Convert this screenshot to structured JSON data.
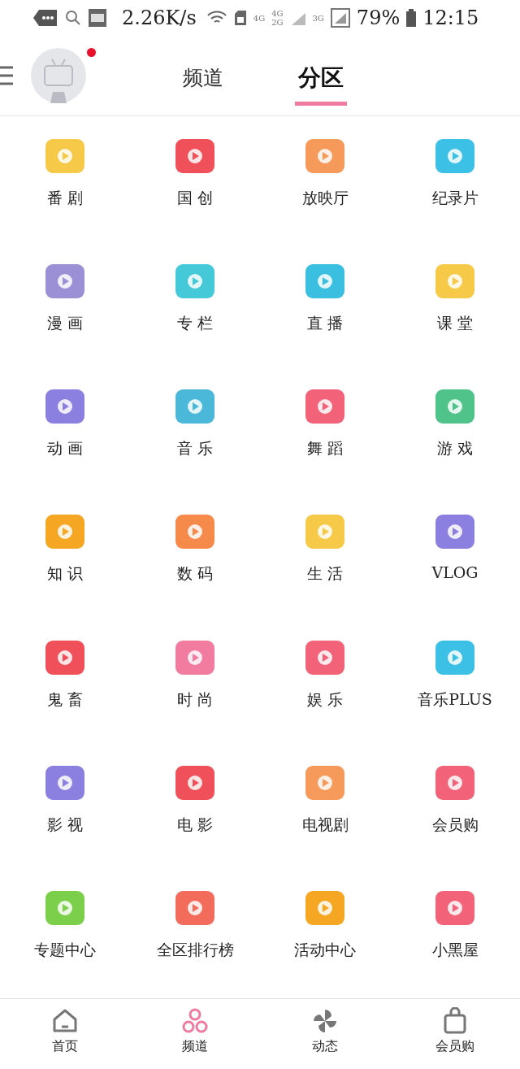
{
  "status_bar": {
    "speed": "2.26K/s",
    "net_1": "4G",
    "net_2": "4G",
    "net_3": "2G",
    "net_4": "3G",
    "battery": "79%",
    "time": "12:15"
  },
  "header": {
    "notification_dot": true,
    "tabs": [
      {
        "label": "频道",
        "selected": false
      },
      {
        "label": "分区",
        "selected": true
      }
    ]
  },
  "categories": [
    {
      "label": "番 剧"
    },
    {
      "label": "国 创"
    },
    {
      "label": "放映厅"
    },
    {
      "label": "纪录片"
    },
    {
      "label": "漫 画"
    },
    {
      "label": "专 栏"
    },
    {
      "label": "直 播"
    },
    {
      "label": "课 堂"
    },
    {
      "label": "动 画"
    },
    {
      "label": "音 乐"
    },
    {
      "label": "舞 蹈"
    },
    {
      "label": "游 戏"
    },
    {
      "label": "知 识"
    },
    {
      "label": "数 码"
    },
    {
      "label": "生 活"
    },
    {
      "label": "VLOG"
    },
    {
      "label": "鬼 畜"
    },
    {
      "label": "时 尚"
    },
    {
      "label": "娱 乐"
    },
    {
      "label": "音乐PLUS"
    },
    {
      "label": "影 视"
    },
    {
      "label": "电 影"
    },
    {
      "label": "电视剧"
    },
    {
      "label": "会员购"
    },
    {
      "label": "专题中心"
    },
    {
      "label": "全区排行榜"
    },
    {
      "label": "活动中心"
    },
    {
      "label": "小黑屋"
    }
  ],
  "bottom_nav": [
    {
      "label": "首页",
      "selected": false
    },
    {
      "label": "频道",
      "selected": true
    },
    {
      "label": "动态",
      "selected": false
    },
    {
      "label": "会员购",
      "selected": false
    }
  ]
}
